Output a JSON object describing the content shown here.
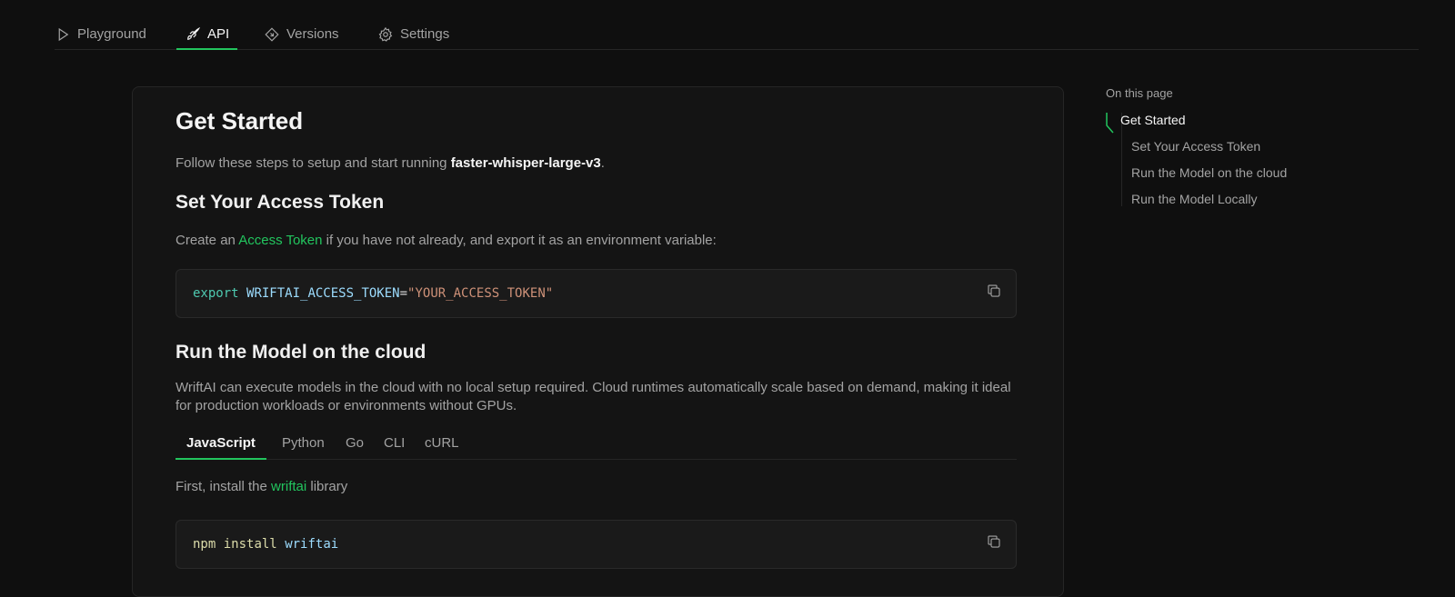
{
  "nav": {
    "tabs": [
      {
        "label": "Playground",
        "icon": "play-icon"
      },
      {
        "label": "API",
        "icon": "rocket-icon",
        "active": true
      },
      {
        "label": "Versions",
        "icon": "diamond-icon"
      },
      {
        "label": "Settings",
        "icon": "gear-icon"
      }
    ]
  },
  "main": {
    "title": "Get Started",
    "intro_prefix": "Follow these steps to setup and start running ",
    "model_name": "faster-whisper-large-v3",
    "intro_suffix": ".",
    "token_section": {
      "heading": "Set Your Access Token",
      "text_prefix": "Create an ",
      "link": "Access Token",
      "text_suffix": " if you have not already, and export it as an environment variable:",
      "code": {
        "keyword": "export",
        "variable": "WRIFTAI_ACCESS_TOKEN",
        "equals": "=",
        "value": "\"YOUR_ACCESS_TOKEN\""
      }
    },
    "cloud_section": {
      "heading": "Run the Model on the cloud",
      "description": "WriftAI can execute models in the cloud with no local setup required. Cloud runtimes automatically scale based on demand, making it ideal for production workloads or environments without GPUs.",
      "languages": [
        "JavaScript",
        "Python",
        "Go",
        "CLI",
        "cURL"
      ],
      "active_language": "JavaScript",
      "install_prefix": "First, install the ",
      "install_link": "wriftai",
      "install_suffix": " library",
      "install_code": {
        "cmd": "npm",
        "sub": "install",
        "pkg": "wriftai"
      }
    }
  },
  "toc": {
    "heading": "On this page",
    "items": [
      "Get Started",
      "Set Your Access Token",
      "Run the Model on the cloud",
      "Run the Model Locally"
    ]
  },
  "colors": {
    "accent": "#22c55e",
    "background": "#0f0f0f"
  }
}
